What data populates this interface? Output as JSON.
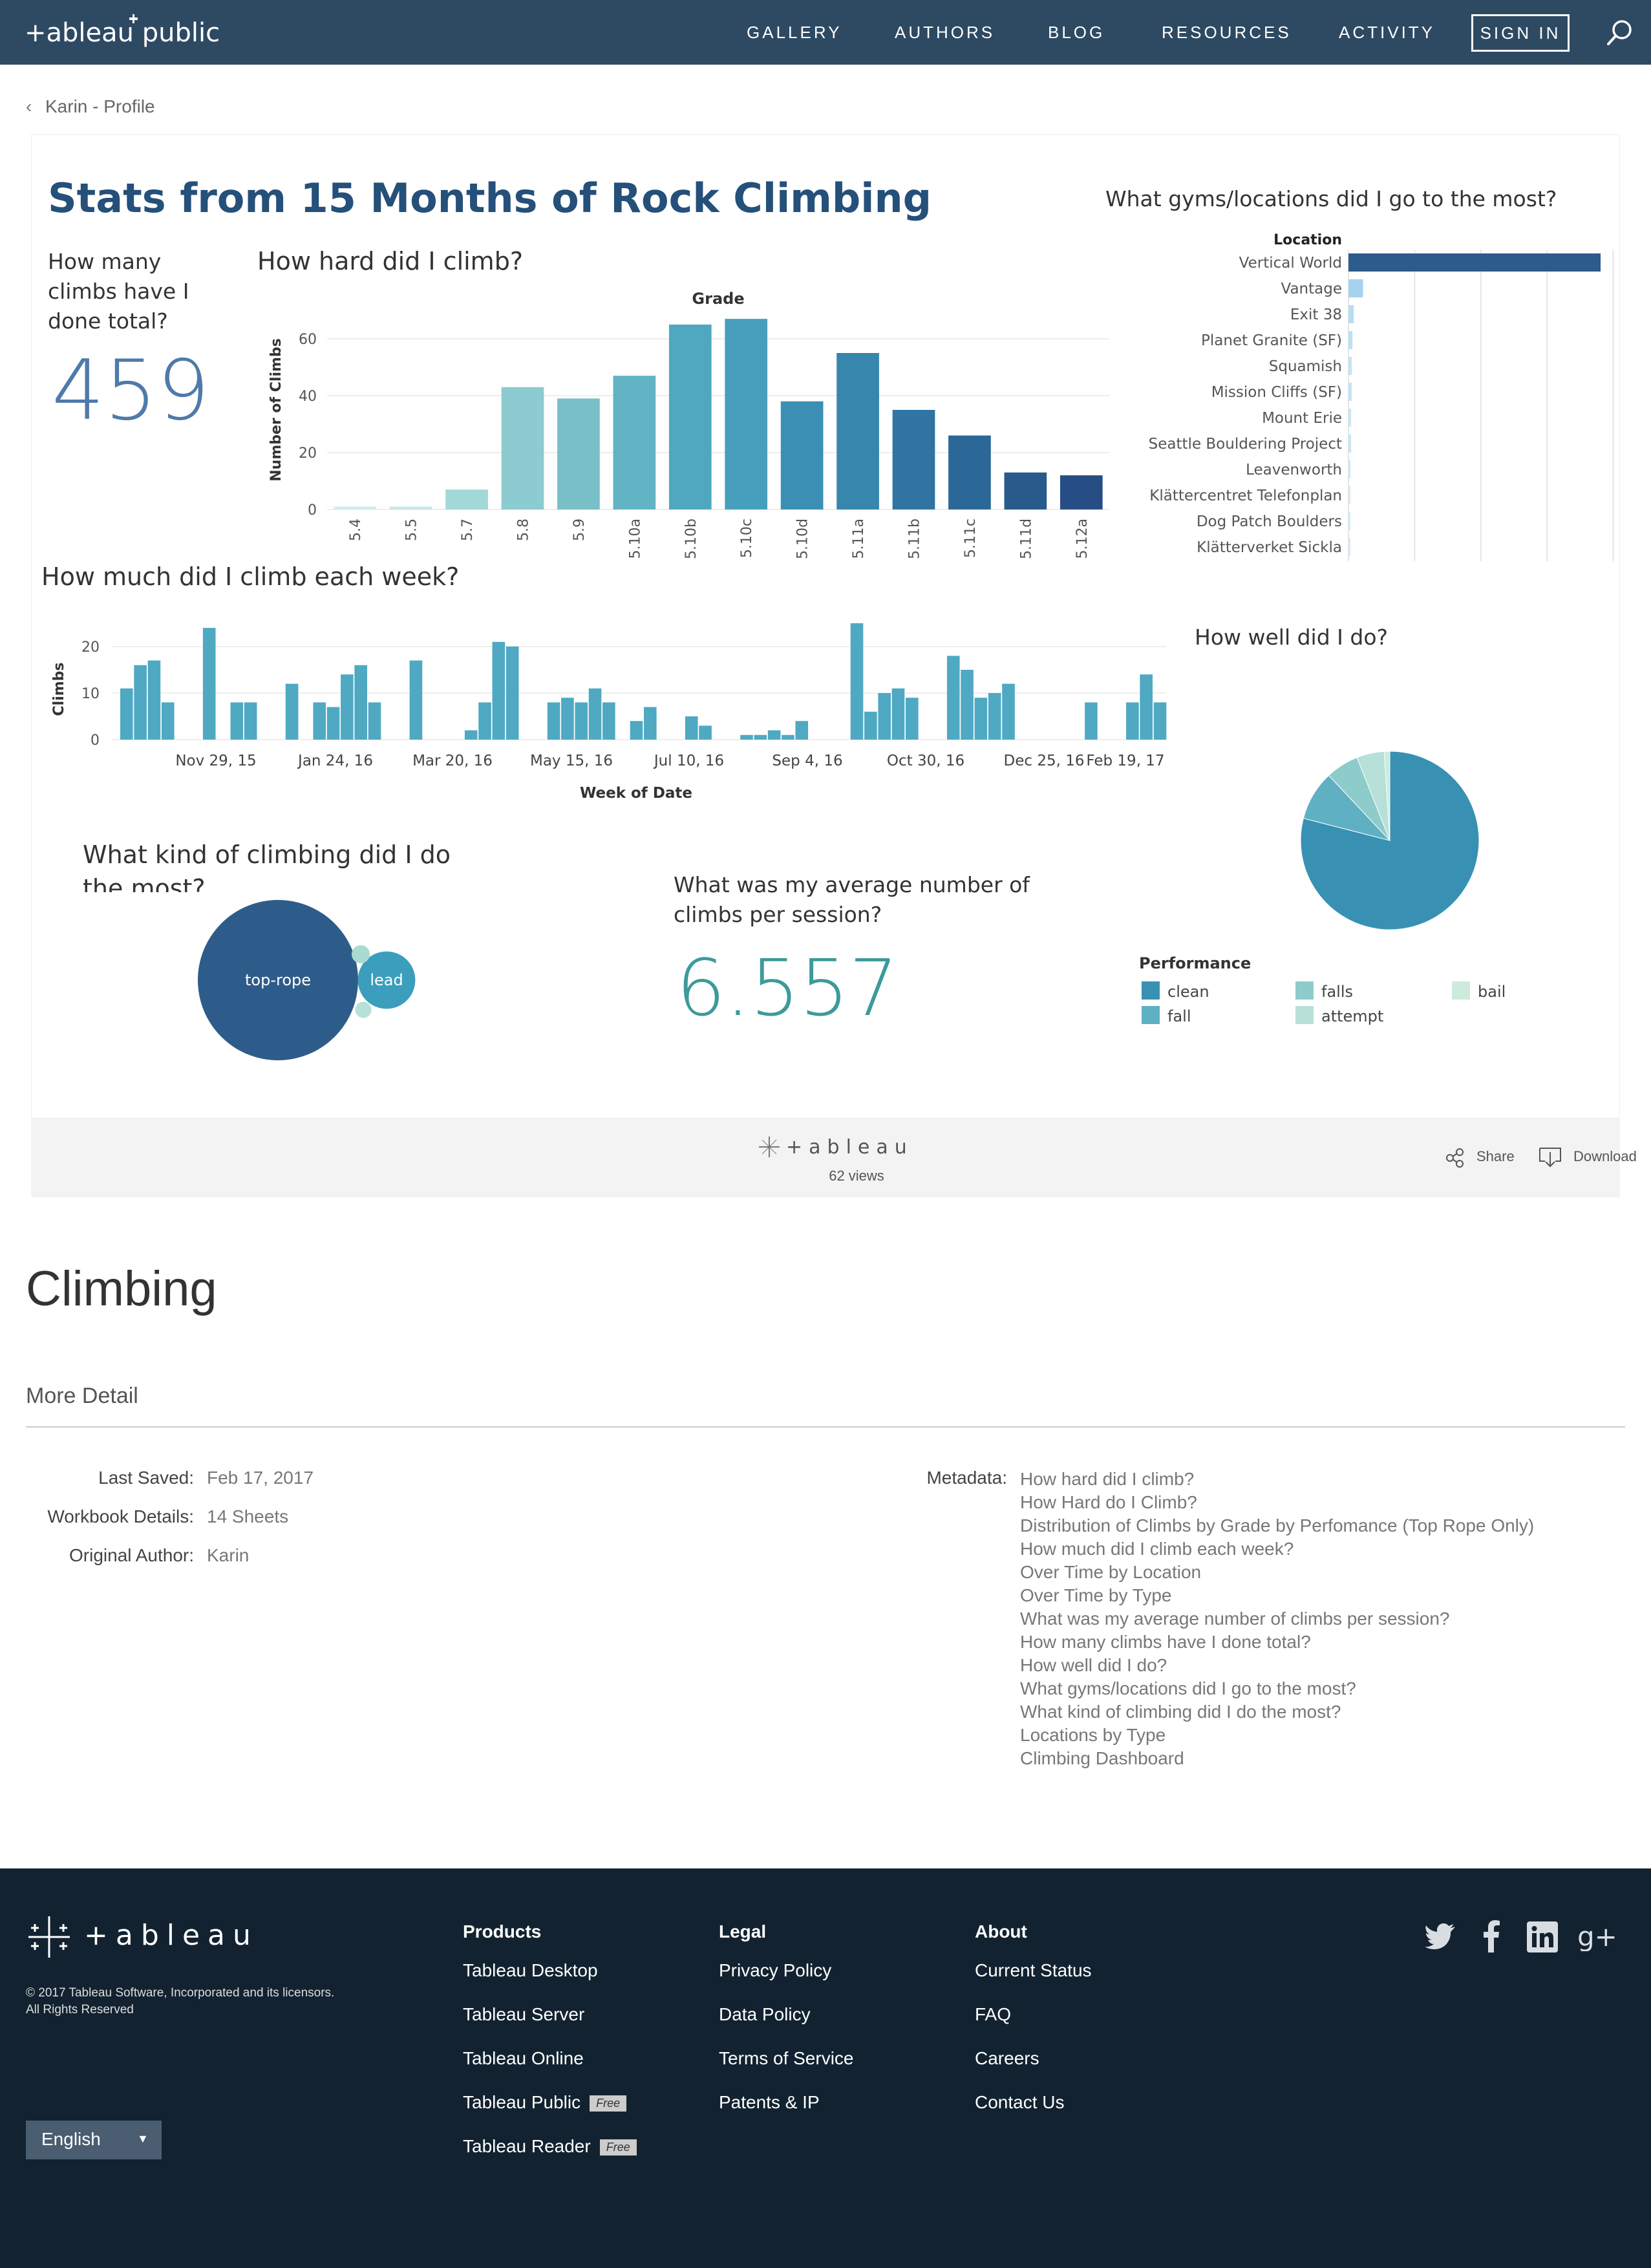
{
  "nav": {
    "items": [
      "GALLERY",
      "AUTHORS",
      "BLOG",
      "RESOURCES",
      "ACTIVITY"
    ],
    "sign_in": "SIGN IN",
    "logo_text": "+ableau public",
    "search_icon": "search-icon"
  },
  "breadcrumb": {
    "back_label": "Karin - Profile"
  },
  "dashboard": {
    "title": "Stats from 15 Months of Rock Climbing",
    "total": {
      "title": "How many climbs have I done total?",
      "value": "459"
    },
    "grades": {
      "title": "How hard did I climb?",
      "header": "Grade",
      "ylabel": "Number of Climbs",
      "yticks": [
        "60",
        "40",
        "20",
        "0"
      ]
    },
    "locations": {
      "title": "What gyms/locations did I go to the most?",
      "header": "Location"
    },
    "weekly": {
      "title": "How much did I climb each week?",
      "ylabel": "Climbs",
      "xlabel": "Week of Date",
      "yticks": [
        "20",
        "10",
        "0"
      ],
      "xticks": [
        "Nov 29, 15",
        "Jan 24, 16",
        "Mar 20, 16",
        "May 15, 16",
        "Jul 10, 16",
        "Sep 4, 16",
        "Oct 30, 16",
        "Dec 25, 16",
        "Feb 19, 17"
      ]
    },
    "types": {
      "title": "What kind of climbing did I do the most?"
    },
    "avg": {
      "title": "What was my average number of climbs per session?",
      "value": "6.557"
    },
    "performance": {
      "title": "How well did I do?",
      "legend_title": "Performance"
    }
  },
  "chart_data": [
    {
      "type": "bar",
      "title": "How hard did I climb?",
      "xlabel": "Grade",
      "ylabel": "Number of Climbs",
      "categories": [
        "5.4",
        "5.5",
        "5.7",
        "5.8",
        "5.9",
        "5.10a",
        "5.10b",
        "5.10c",
        "5.10d",
        "5.11a",
        "5.11b",
        "5.11c",
        "5.11d",
        "5.12a"
      ],
      "values": [
        1,
        1,
        7,
        43,
        39,
        47,
        65,
        67,
        38,
        55,
        35,
        26,
        13,
        12
      ],
      "ylim": [
        0,
        70
      ],
      "colors": [
        "#cfeeee",
        "#c4e8e8",
        "#a3d8d8",
        "#8ccbd0",
        "#79bfc8",
        "#62b3c3",
        "#4fa8c0",
        "#469fbd",
        "#3b8fb4",
        "#3686ad",
        "#2f74a2",
        "#2b6797",
        "#285a8c",
        "#264e84"
      ]
    },
    {
      "type": "bar",
      "orientation": "horizontal",
      "title": "What gyms/locations did I go to the most?",
      "xlabel": "Location",
      "categories": [
        "Vertical World",
        "Vantage",
        "Exit 38",
        "Planet Granite (SF)",
        "Squamish",
        "Mission Cliffs (SF)",
        "Mount Erie",
        "Seattle Bouldering Project",
        "Leavenworth",
        "Klättercentret Telefonplan",
        "Dog Patch Boulders",
        "Klätterverket Sickla"
      ],
      "values": [
        380,
        22,
        8,
        6,
        5,
        5,
        4,
        4,
        3,
        1,
        1,
        1
      ],
      "colors": [
        "#2c5b8c",
        "#a6d2ef",
        "#b8dcf1",
        "#bde0f2",
        "#c5e3f3",
        "#c5e3f3",
        "#c9e5f3",
        "#c9e5f3",
        "#cde7f4",
        "#d3eaf5",
        "#d3eaf5",
        "#d3eaf5"
      ]
    },
    {
      "type": "bar",
      "title": "How much did I climb each week?",
      "xlabel": "Week of Date",
      "ylabel": "Climbs",
      "x": [
        "Nov 29, 15",
        "Jan 24, 16",
        "Mar 20, 16",
        "May 15, 16",
        "Jul 10, 16",
        "Sep 4, 16",
        "Oct 30, 16",
        "Dec 25, 16",
        "Feb 19, 17"
      ],
      "values": [
        11,
        16,
        17,
        8,
        0,
        0,
        24,
        0,
        8,
        8,
        0,
        0,
        12,
        0,
        8,
        7,
        14,
        16,
        8,
        0,
        0,
        17,
        0,
        0,
        0,
        2,
        8,
        21,
        20,
        0,
        0,
        8,
        9,
        8,
        11,
        8,
        0,
        4,
        7,
        0,
        0,
        5,
        3,
        0,
        0,
        1,
        1,
        2,
        1,
        4,
        0,
        0,
        0,
        25,
        6,
        10,
        11,
        9,
        0,
        0,
        18,
        15,
        9,
        10,
        12,
        0,
        0,
        0,
        0,
        0,
        8,
        0,
        0,
        8,
        14,
        8
      ],
      "ylim": [
        0,
        25
      ],
      "color": "#4fa9c2"
    },
    {
      "type": "pie",
      "title": "How well did I do?",
      "legend_title": "Performance",
      "categories": [
        "clean",
        "fall",
        "falls",
        "attempt",
        "bail"
      ],
      "values": [
        79,
        9,
        6,
        5,
        1
      ],
      "colors": [
        "#3891b3",
        "#5fb0c3",
        "#8ecbcb",
        "#b6e0d8",
        "#cdebdc"
      ]
    },
    {
      "type": "bubble",
      "title": "What kind of climbing did I do the most?",
      "categories": [
        "top-rope",
        "lead",
        "",
        ""
      ],
      "values": [
        390,
        50,
        5,
        4
      ],
      "colors": [
        "#2e5c8a",
        "#3b9ebc",
        "#a9dbd2",
        "#b7e1d8"
      ]
    }
  ],
  "viz_footer": {
    "brand": "+ableau",
    "views": "62 views",
    "share": "Share",
    "download": "Download"
  },
  "workbook": {
    "title": "Climbing",
    "more_detail": "More Detail",
    "last_saved_label": "Last Saved:",
    "last_saved": "Feb 17, 2017",
    "details_label": "Workbook Details:",
    "details": "14 Sheets",
    "author_label": "Original Author:",
    "author": "Karin",
    "metadata_label": "Metadata:",
    "metadata": [
      "How hard did I climb?",
      "How Hard do I Climb?",
      "Distribution of Climbs by Grade by Perfomance (Top Rope Only)",
      "How much did I climb each week?",
      "Over Time by Location",
      "Over Time by Type",
      "What was my average number of climbs per session?",
      "How many climbs have I done total?",
      "How well did I do?",
      "What gyms/locations did I go to the most?",
      "What kind of climbing did I do the most?",
      "Locations by Type",
      "Climbing Dashboard"
    ]
  },
  "footer": {
    "brand": "+ableau",
    "copyright1": "© 2017 Tableau Software, Incorporated and its licensors.",
    "copyright2": "All Rights Reserved",
    "language": "English",
    "free_badge": "Free",
    "products": {
      "title": "Products",
      "items": [
        "Tableau Desktop",
        "Tableau Server",
        "Tableau Online",
        "Tableau Public",
        "Tableau Reader"
      ]
    },
    "legal": {
      "title": "Legal",
      "items": [
        "Privacy Policy",
        "Data Policy",
        "Terms of Service",
        "Patents & IP"
      ]
    },
    "about": {
      "title": "About",
      "items": [
        "Current Status",
        "FAQ",
        "Careers",
        "Contact Us"
      ]
    },
    "social": [
      "twitter-icon",
      "facebook-icon",
      "linkedin-icon",
      "google-plus-icon"
    ]
  }
}
